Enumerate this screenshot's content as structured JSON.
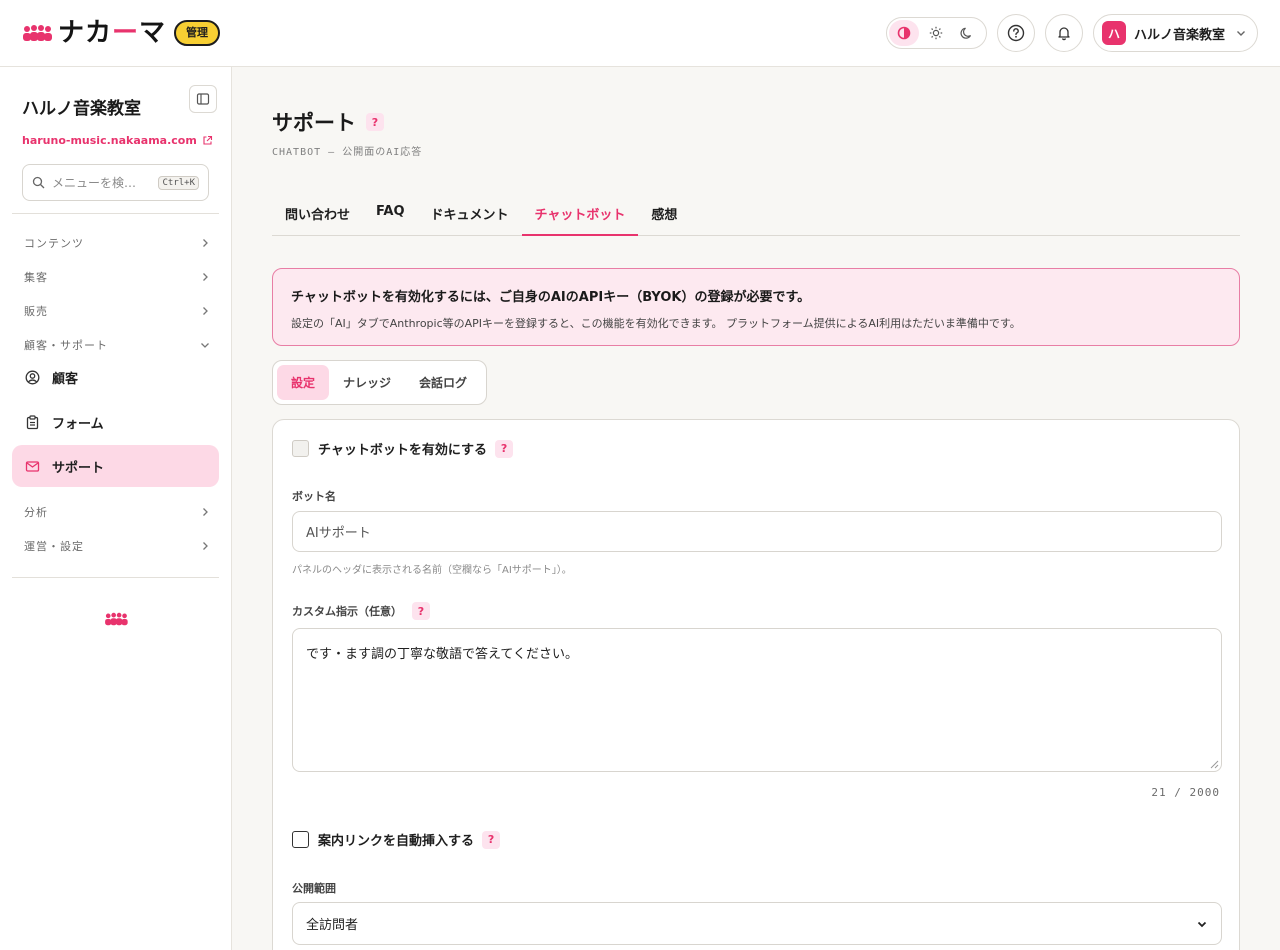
{
  "header": {
    "brand_name_a": "ナカ",
    "brand_name_dash": "ー",
    "brand_name_b": "マ",
    "admin_badge": "管理",
    "org_avatar": "ハ",
    "org_name": "ハルノ音楽教室",
    "icons": [
      "contrast-icon",
      "sun-icon",
      "moon-icon",
      "help-circle-icon",
      "bell-icon",
      "chevron-down-icon"
    ],
    "accent_color": "#e8336d"
  },
  "sidebar": {
    "title": "ハルノ音楽教室",
    "site_link": "haruno-music.nakaama.com",
    "search_placeholder": "メニューを検…",
    "search_shortcut": "Ctrl+K",
    "sections": [
      {
        "label": "コンテンツ"
      },
      {
        "label": "集客"
      },
      {
        "label": "販売"
      },
      {
        "label": "顧客・サポート"
      }
    ],
    "items": [
      {
        "label": "顧客"
      },
      {
        "label": "フォーム"
      },
      {
        "label": "サポート"
      }
    ],
    "sections_after": [
      {
        "label": "分析"
      },
      {
        "label": "運営・設定"
      }
    ]
  },
  "main": {
    "title": "サポート",
    "help": "?",
    "subtitle": "CHATBOT — 公開面のAI応答",
    "tabs": [
      {
        "label": "問い合わせ"
      },
      {
        "label": "FAQ"
      },
      {
        "label": "ドキュメント"
      },
      {
        "label": "チャットボット"
      },
      {
        "label": "感想"
      }
    ],
    "alert": {
      "title": "チャットボットを有効化するには、ご自身のAIのAPIキー（BYOK）の登録が必要です。",
      "body": "設定の「AI」タブでAnthropic等のAPIキーを登録すると、この機能を有効化できます。 プラットフォーム提供によるAI利用はただいま準備中です。"
    },
    "subtabs": [
      {
        "label": "設定"
      },
      {
        "label": "ナレッジ"
      },
      {
        "label": "会話ログ"
      }
    ],
    "form": {
      "enable_label": "チャットボットを有効にする",
      "bot_name_label": "ボット名",
      "bot_name_placeholder": "AIサポート",
      "bot_name_hint": "パネルのヘッダに表示される名前（空欄なら「AIサポート」）。",
      "custom_label": "カスタム指示（任意）",
      "custom_value": "です・ます調の丁寧な敬語で答えてください。",
      "counter": "21 / 2000",
      "auto_link_label": "案内リンクを自動挿入する",
      "scope_label": "公開範囲",
      "scope_value": "全訪問者"
    }
  }
}
